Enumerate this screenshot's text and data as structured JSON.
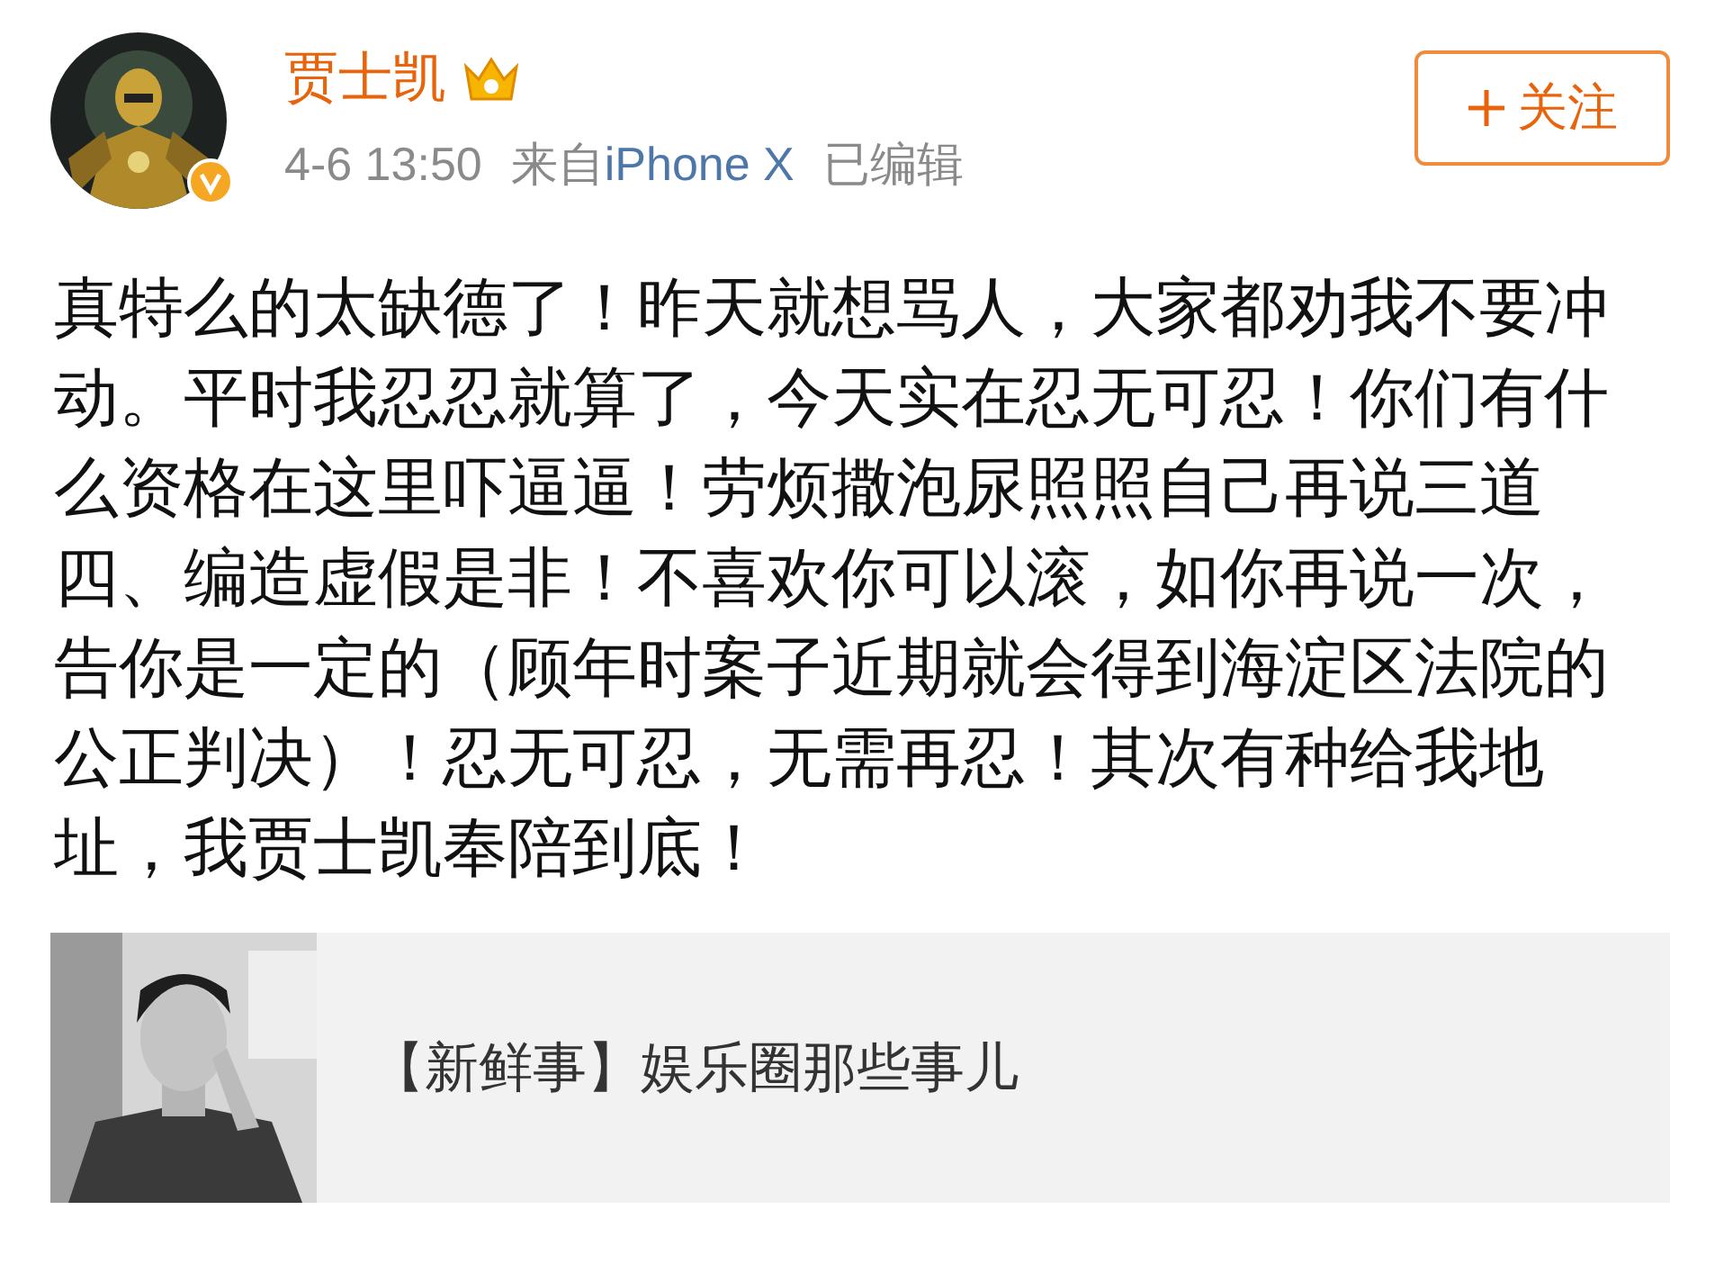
{
  "author": {
    "name": "贾士凯",
    "verified": true,
    "vip": true
  },
  "meta": {
    "time": "4-6 13:50",
    "source_prefix": "来自",
    "source": "iPhone X",
    "edited": "已编辑"
  },
  "follow_button": {
    "label": "关注"
  },
  "post_text": "真特么的太缺德了！昨天就想骂人，大家都劝我不要冲动。平时我忍忍就算了，今天实在忍无可忍！你们有什么资格在这里吓逼逼！劳烦撒泡尿照照自己再说三道四、编造虚假是非！不喜欢你可以滚，如你再说一次，告你是一定的（顾年时案子近期就会得到海淀区法院的公正判决）！忍无可忍，无需再忍！其次有种给我地址，我贾士凯奉陪到底！",
  "card": {
    "title": "【新鲜事】娱乐圈那些事儿"
  }
}
